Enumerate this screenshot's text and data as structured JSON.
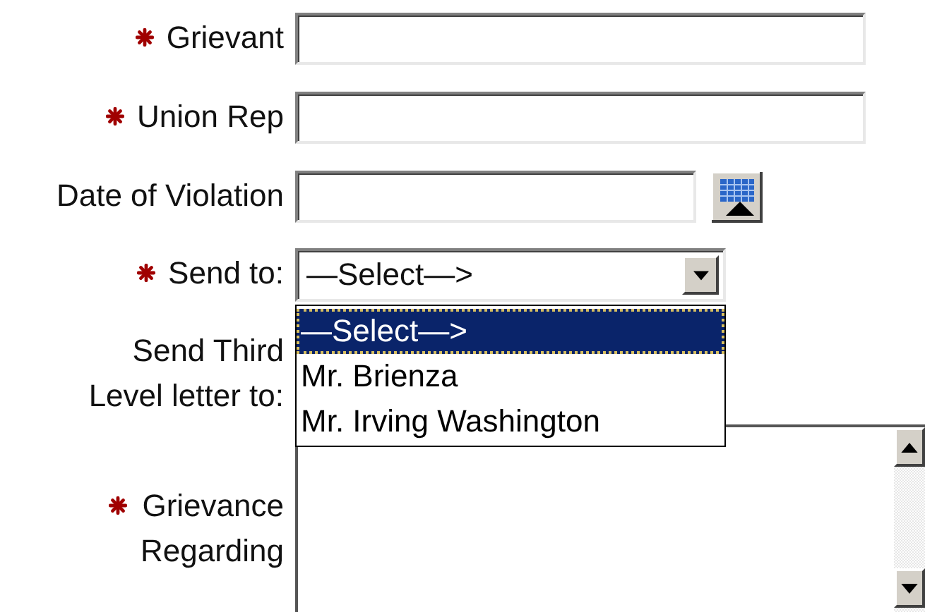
{
  "fields": [
    {
      "kind": "text",
      "label": "Grievant",
      "required": true
    },
    {
      "kind": "text",
      "label": "Union Rep",
      "required": true
    },
    {
      "kind": "date",
      "label": "Date of Violation",
      "required": false
    },
    {
      "kind": "select",
      "label": "Send to:",
      "required": true,
      "value": "—Select—>",
      "expanded": true,
      "options": [
        {
          "label": "—Select—>",
          "selected": true
        },
        {
          "label": "Mr. Brienza",
          "selected": false
        },
        {
          "label": "Mr. Irving Washington",
          "selected": false
        }
      ]
    },
    {
      "kind": "covered",
      "label": "Send Third\nLevel letter to:",
      "required": false
    },
    {
      "kind": "textarea",
      "label": "Grievance\nRegarding",
      "required": true
    }
  ]
}
